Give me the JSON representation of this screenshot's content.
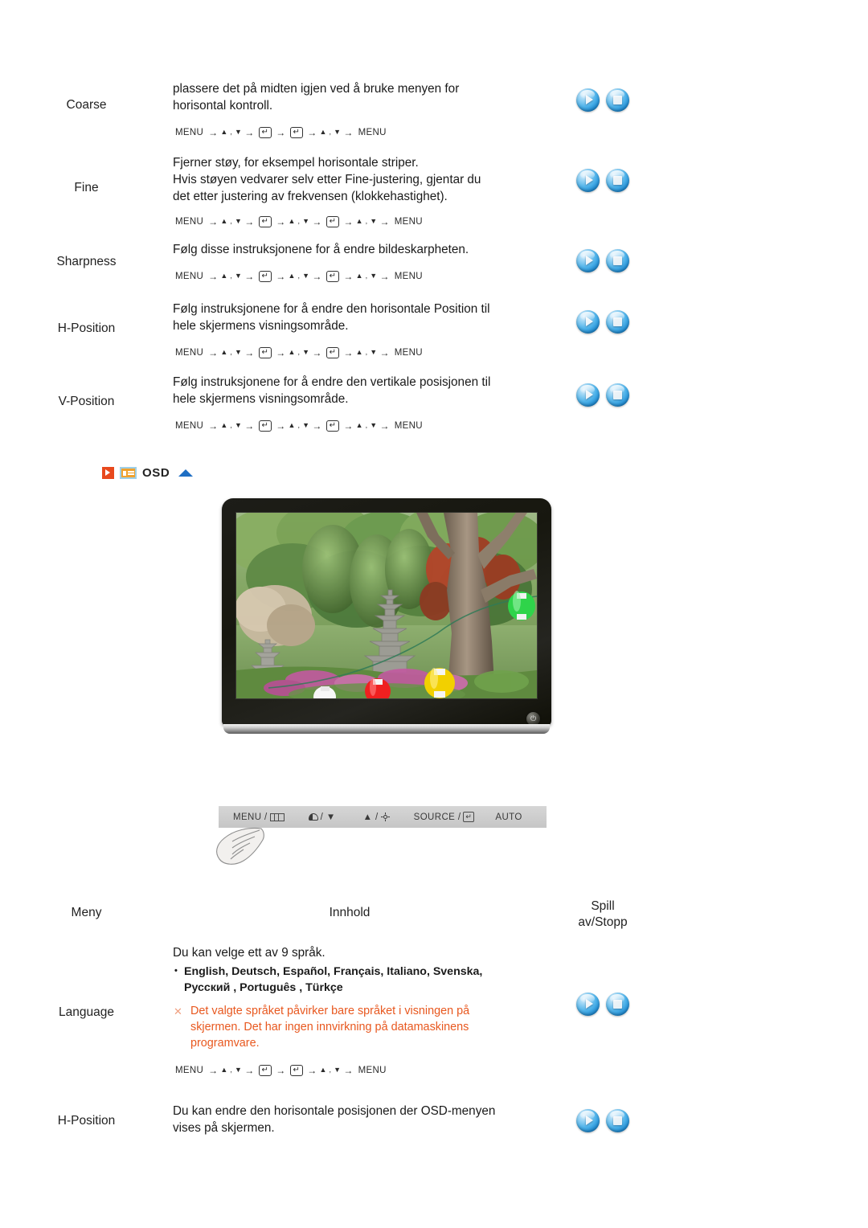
{
  "page": {
    "language_code": "no",
    "accent_orange": "#e8491d",
    "warning_color": "#e8581f",
    "blue_accent": "#1f6fc4"
  },
  "rows_top": [
    {
      "menu": "Coarse",
      "desc_lines": [
        "plassere det på midten igjen ved å bruke menyen for",
        "horisontal kontroll."
      ],
      "sequence": [
        "MENU",
        "▲ , ▼",
        "enter",
        "enter",
        "▲ , ▼",
        "MENU"
      ],
      "play_label": "play-icon",
      "stop_label": "stop-icon"
    },
    {
      "menu": "Fine",
      "desc_lines": [
        "Fjerner støy, for eksempel horisontale striper.",
        "Hvis støyen vedvarer selv etter Fine-justering, gjentar du",
        "det etter justering av frekvensen (klokkehastighet)."
      ],
      "sequence": [
        "MENU",
        "▲ , ▼",
        "enter",
        "▲ , ▼",
        "enter",
        "▲ , ▼",
        "MENU"
      ],
      "play_label": "play-icon",
      "stop_label": "stop-icon"
    },
    {
      "menu": "Sharpness",
      "desc_lines": [
        "Følg disse instruksjonene for å endre bildeskarpheten."
      ],
      "sequence": [
        "MENU",
        "▲ , ▼",
        "enter",
        "▲ , ▼",
        "enter",
        "▲ , ▼",
        "MENU"
      ],
      "play_label": "play-icon",
      "stop_label": "stop-icon"
    },
    {
      "menu": "H-Position",
      "desc_lines": [
        "Følg instruksjonene for å endre den horisontale Position til",
        "hele skjermens visningsområde."
      ],
      "sequence": [
        "MENU",
        "▲ , ▼",
        "enter",
        "▲ , ▼",
        "enter",
        "▲ , ▼",
        "MENU"
      ],
      "play_label": "play-icon",
      "stop_label": "stop-icon"
    },
    {
      "menu": "V-Position",
      "desc_lines": [
        "Følg instruksjonene for å endre den vertikale posisjonen til",
        "hele skjermens visningsområde."
      ],
      "sequence": [
        "MENU",
        "▲ , ▼",
        "enter",
        "▲ , ▼",
        "enter",
        "▲ , ▼",
        "MENU"
      ],
      "play_label": "play-icon",
      "stop_label": "stop-icon"
    }
  ],
  "osd_section": {
    "title": "OSD",
    "red_icon": "red-play-icon",
    "monitor_icon": "monitor-icon",
    "up_icon": "up-triangle-icon"
  },
  "monitor": {
    "screen_alt": "garden-photo-with-stone-pagoda-and-lanterns",
    "power_glyph": "⏻"
  },
  "button_strip": {
    "items": [
      {
        "label": "MENU /",
        "icon": "menu-bars-icon"
      },
      {
        "label": "/ ▼",
        "icon": "contrast-icon"
      },
      {
        "label": "▲ /",
        "icon": "brightness-sun-icon"
      },
      {
        "label": "SOURCE /",
        "icon": "enter-key-icon"
      },
      {
        "label": "AUTO",
        "icon": ""
      }
    ],
    "hand_icon": "pointing-hand-icon"
  },
  "table_header": {
    "menu": "Meny",
    "content": "Innhold",
    "play_stop_line1": "Spill",
    "play_stop_line2": "av/Stopp"
  },
  "rows_bottom": [
    {
      "menu": "Language",
      "intro": "Du kan velge ett av 9 språk.",
      "languages_line1": "English, Deutsch, Español, Français,  Italiano, Svenska,",
      "languages_line2": "Русский , Português , Türkçe",
      "warning_lines": [
        "Det valgte språket påvirker bare språket i visningen på",
        "skjermen. Det har ingen innvirkning på datamaskinens",
        "programvare."
      ],
      "warning_mark": "✕",
      "sequence": [
        "MENU",
        "▲ , ▼",
        "enter",
        "enter",
        "▲ , ▼",
        "MENU"
      ],
      "play_label": "play-icon",
      "stop_label": "stop-icon"
    },
    {
      "menu": "H-Position",
      "desc_lines": [
        "Du kan endre den horisontale posisjonen der OSD-menyen",
        "vises på skjermen."
      ],
      "play_label": "play-icon",
      "stop_label": "stop-icon"
    }
  ]
}
